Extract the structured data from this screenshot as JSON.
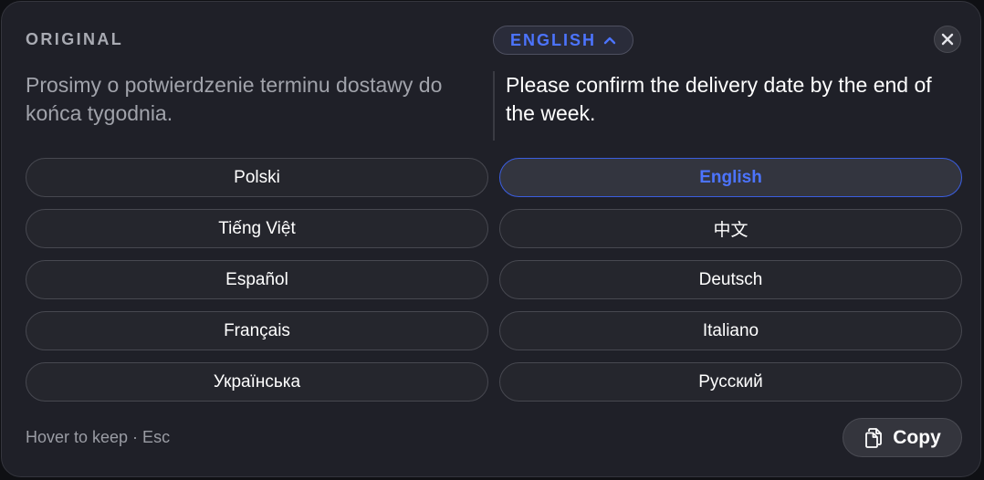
{
  "header": {
    "original_label": "ORIGINAL",
    "target_language": "ENGLISH"
  },
  "source_text": "Prosimy o potwierdzenie terminu dostawy do końca tygodnia.",
  "target_text": "Please confirm the delivery date by the end of the week.",
  "languages": [
    {
      "label": "Polski",
      "selected": false
    },
    {
      "label": "English",
      "selected": true
    },
    {
      "label": "Tiếng Việt",
      "selected": false
    },
    {
      "label": "中文",
      "selected": false
    },
    {
      "label": "Español",
      "selected": false
    },
    {
      "label": "Deutsch",
      "selected": false
    },
    {
      "label": "Français",
      "selected": false
    },
    {
      "label": "Italiano",
      "selected": false
    },
    {
      "label": "Українська",
      "selected": false
    },
    {
      "label": "Русский",
      "selected": false
    }
  ],
  "footer": {
    "hint": "Hover to keep · Esc",
    "copy_label": "Copy"
  },
  "icons": {
    "close": "close-icon",
    "chevron": "chevron-up-icon",
    "copy": "copy-icon"
  },
  "colors": {
    "accent": "#4c74ff",
    "panel_bg": "#1f2028"
  }
}
